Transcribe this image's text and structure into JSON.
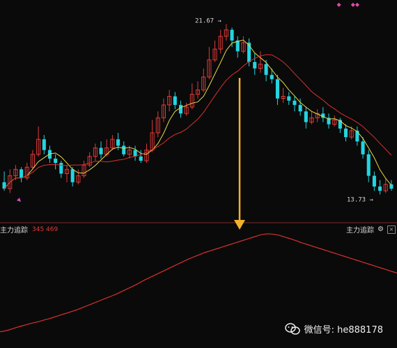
{
  "chart_data": [
    {
      "type": "candlestick",
      "price_labels": {
        "high": "21.67",
        "low": "13.73"
      },
      "ylim": [
        12.9,
        22.4
      ],
      "colors": {
        "up": "#e03a3a",
        "down": "#23d5e0",
        "ma_short": "#e8d84a",
        "ma_long": "#d93030"
      },
      "candles": [
        [
          14.3,
          14.0,
          14.8,
          13.9
        ],
        [
          14.0,
          14.6,
          14.9,
          13.8
        ],
        [
          14.6,
          14.9,
          15.1,
          14.4
        ],
        [
          14.9,
          14.5,
          15.0,
          14.3
        ],
        [
          14.5,
          15.0,
          15.2,
          14.4
        ],
        [
          15.0,
          15.6,
          15.8,
          14.9
        ],
        [
          15.6,
          16.3,
          16.9,
          15.5
        ],
        [
          16.3,
          15.8,
          16.5,
          15.6
        ],
        [
          15.8,
          15.4,
          16.0,
          15.2
        ],
        [
          15.4,
          15.2,
          15.6,
          14.9
        ],
        [
          15.2,
          14.7,
          15.3,
          14.5
        ],
        [
          14.7,
          14.9,
          15.1,
          14.3
        ],
        [
          14.9,
          14.3,
          15.0,
          14.1
        ],
        [
          14.3,
          14.6,
          14.9,
          14.2
        ],
        [
          14.6,
          15.1,
          15.3,
          14.5
        ],
        [
          15.1,
          15.5,
          15.7,
          15.0
        ],
        [
          15.5,
          15.9,
          16.1,
          15.3
        ],
        [
          15.9,
          15.6,
          16.2,
          15.4
        ],
        [
          15.6,
          15.9,
          16.3,
          15.5
        ],
        [
          15.9,
          16.3,
          16.5,
          15.8
        ],
        [
          16.3,
          16.0,
          16.6,
          15.8
        ],
        [
          16.0,
          15.6,
          16.2,
          15.5
        ],
        [
          15.6,
          15.8,
          16.0,
          15.4
        ],
        [
          15.8,
          15.5,
          16.0,
          15.3
        ],
        [
          15.5,
          15.3,
          15.8,
          15.2
        ],
        [
          15.3,
          15.8,
          16.1,
          15.2
        ],
        [
          15.8,
          16.6,
          17.2,
          15.7
        ],
        [
          16.6,
          17.3,
          17.6,
          16.4
        ],
        [
          17.3,
          17.9,
          18.2,
          17.1
        ],
        [
          17.9,
          18.3,
          18.6,
          17.6
        ],
        [
          18.3,
          17.9,
          18.5,
          17.7
        ],
        [
          17.9,
          17.5,
          18.1,
          17.3
        ],
        [
          17.5,
          17.8,
          18.0,
          17.4
        ],
        [
          17.8,
          18.4,
          18.9,
          17.7
        ],
        [
          18.4,
          18.6,
          19.0,
          18.2
        ],
        [
          18.6,
          19.2,
          19.6,
          18.5
        ],
        [
          19.2,
          20.0,
          20.6,
          19.1
        ],
        [
          20.0,
          20.5,
          20.9,
          19.9
        ],
        [
          20.5,
          21.1,
          21.4,
          20.3
        ],
        [
          21.1,
          21.4,
          21.67,
          20.9
        ],
        [
          21.4,
          20.9,
          21.5,
          20.6
        ],
        [
          20.9,
          20.4,
          21.1,
          20.1
        ],
        [
          20.4,
          20.8,
          21.1,
          20.3
        ],
        [
          20.8,
          19.9,
          21.0,
          19.7
        ],
        [
          19.9,
          19.6,
          20.3,
          19.3
        ],
        [
          19.6,
          19.8,
          20.4,
          19.4
        ],
        [
          19.8,
          19.3,
          20.0,
          19.0
        ],
        [
          19.3,
          19.1,
          19.6,
          18.9
        ],
        [
          19.1,
          18.2,
          19.3,
          17.9
        ],
        [
          18.2,
          18.3,
          18.7,
          18.0
        ],
        [
          18.3,
          18.1,
          18.5,
          17.9
        ],
        [
          18.1,
          17.9,
          18.3,
          17.6
        ],
        [
          17.9,
          17.6,
          18.2,
          17.4
        ],
        [
          17.6,
          17.1,
          17.8,
          16.8
        ],
        [
          17.1,
          17.3,
          17.6,
          17.0
        ],
        [
          17.3,
          17.5,
          17.7,
          17.1
        ],
        [
          17.5,
          17.3,
          17.8,
          17.1
        ],
        [
          17.3,
          17.0,
          17.5,
          16.8
        ],
        [
          17.0,
          17.2,
          17.4,
          16.9
        ],
        [
          17.2,
          16.8,
          17.3,
          16.6
        ],
        [
          16.8,
          16.4,
          17.0,
          16.2
        ],
        [
          16.4,
          16.7,
          16.9,
          16.3
        ],
        [
          16.7,
          16.2,
          16.9,
          16.0
        ],
        [
          16.2,
          15.6,
          16.4,
          15.4
        ],
        [
          15.6,
          14.6,
          15.8,
          14.3
        ],
        [
          14.6,
          14.1,
          14.8,
          13.9
        ],
        [
          14.1,
          13.9,
          14.4,
          13.73
        ],
        [
          13.9,
          14.2,
          14.5,
          13.8
        ],
        [
          14.2,
          14.0,
          14.4,
          13.9
        ]
      ]
    },
    {
      "type": "line",
      "indicator": {
        "name": "主力追踪",
        "values_text": "345 469"
      },
      "color": "#d93030",
      "values": [
        40,
        42,
        45,
        49,
        53,
        57,
        60,
        64,
        67,
        70,
        73,
        77,
        80,
        84,
        88,
        92,
        96,
        100,
        104,
        108,
        113,
        118,
        123,
        128,
        133,
        138,
        143,
        148,
        153,
        158,
        164,
        170,
        176,
        182,
        188,
        195,
        202,
        208,
        214,
        220,
        226,
        232,
        238,
        244,
        250,
        256,
        262,
        268,
        273,
        278,
        283,
        288,
        292,
        296,
        300,
        304,
        308,
        312,
        316,
        320,
        324,
        328,
        332,
        336,
        340,
        344,
        346,
        347,
        346,
        344,
        341,
        337,
        333,
        329,
        325,
        320,
        316,
        312,
        308,
        304,
        300,
        296,
        292,
        288,
        284,
        280,
        276,
        272,
        268,
        264,
        260,
        256,
        252,
        248,
        244,
        240,
        236,
        232,
        228,
        224
      ],
      "ylim": [
        0,
        360
      ]
    }
  ],
  "panel": {
    "title": "主力追踪",
    "values": "345 469",
    "right_title": "主力追踪",
    "gear_icon": "gear-icon",
    "settings_icon": "settings-icon"
  },
  "watermark": {
    "text": "微信号: he888178",
    "icon": "wechat-icon"
  },
  "markers": {
    "left": "◆",
    "right": "◆◆"
  }
}
